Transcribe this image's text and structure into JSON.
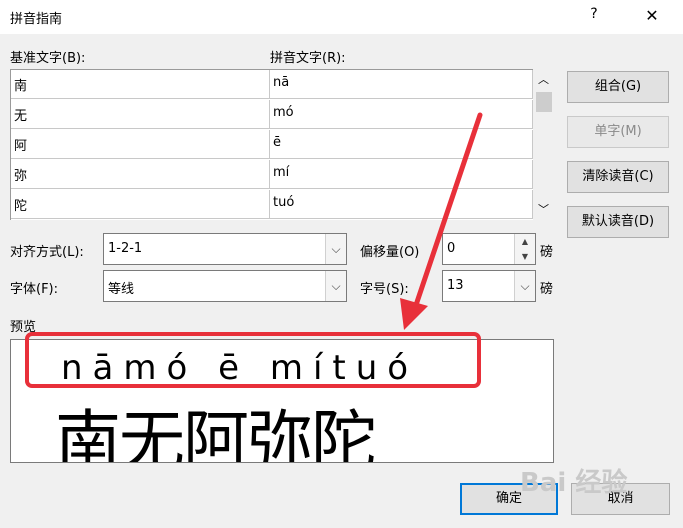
{
  "window": {
    "title": "拼音指南",
    "help": "?",
    "close": "✕"
  },
  "labels": {
    "base_text": "基准文字(B):",
    "pinyin_text": "拼音文字(R):"
  },
  "rows": [
    {
      "base": "南",
      "pinyin": "nā"
    },
    {
      "base": "无",
      "pinyin": "mó"
    },
    {
      "base": "阿",
      "pinyin": "ē"
    },
    {
      "base": "弥",
      "pinyin": "mí"
    },
    {
      "base": "陀",
      "pinyin": "tuó"
    }
  ],
  "buttons": {
    "combine": "组合(G)",
    "single": "单字(M)",
    "clear": "清除读音(C)",
    "default": "默认读音(D)",
    "ok": "确定",
    "cancel": "取消"
  },
  "align": {
    "label": "对齐方式(L):",
    "value": "1-2-1"
  },
  "offset": {
    "label": "偏移量(O)",
    "value": "0",
    "unit": "磅"
  },
  "font": {
    "label": "字体(F):",
    "value": "等线"
  },
  "size": {
    "label": "字号(S):",
    "value": "13",
    "unit": "磅"
  },
  "preview": {
    "label": "预览",
    "pinyin_line": "nāmó ē mítuó",
    "base_line": "南无阿弥陀"
  },
  "scroll": {
    "up": "︿",
    "down": "﹀"
  },
  "combo_arrow": "⌵",
  "spin": {
    "up": "▲",
    "down": "▼"
  },
  "watermark": "Bai 经验",
  "colors": {
    "annotation": "#e8303a",
    "focus": "#0078d7"
  }
}
